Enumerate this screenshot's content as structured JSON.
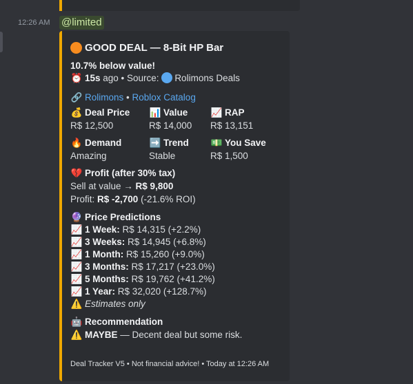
{
  "message": {
    "timestamp": "12:26 AM",
    "mention": "@limited"
  },
  "embed": {
    "accent_color": "#f0a800",
    "title": "GOOD DEAL — 8-Bit HP Bar",
    "below_value": "10.7% below value!",
    "age_value": "15s",
    "age_suffix": " ago • Source: ",
    "source": "Rolimons Deals",
    "links": {
      "rolimons": "Rolimons",
      "sep": " • ",
      "catalog": "Roblox Catalog"
    },
    "fields": [
      {
        "icon": "money-bag-icon",
        "name": "Deal Price",
        "value": "R$ 12,500"
      },
      {
        "icon": "bar-chart-icon",
        "name": "Value",
        "value": "R$ 14,000"
      },
      {
        "icon": "chart-up-icon",
        "name": "RAP",
        "value": "R$ 13,151"
      },
      {
        "icon": "fire-icon",
        "name": "Demand",
        "value": "Amazing"
      },
      {
        "icon": "arrow-right-icon",
        "name": "Trend",
        "value": "Stable"
      },
      {
        "icon": "dollar-bill-icon",
        "name": "You Save",
        "value": "R$ 1,500"
      }
    ],
    "profit": {
      "heading": "Profit (after 30% tax)",
      "sell_prefix": "Sell at value → ",
      "sell_value": "R$ 9,800",
      "profit_prefix": "Profit: ",
      "profit_value": "R$ -2,700",
      "profit_roi": " (-21.6% ROI)"
    },
    "predictions": {
      "heading": "Price Predictions",
      "items": [
        {
          "label": "1 Week:",
          "value": " R$ 14,315 (+2.2%)"
        },
        {
          "label": "3 Weeks:",
          "value": " R$ 14,945 (+6.8%)"
        },
        {
          "label": "1 Month:",
          "value": " R$ 15,260 (+9.0%)"
        },
        {
          "label": "3 Months:",
          "value": " R$ 17,217 (+23.0%)"
        },
        {
          "label": "5 Months:",
          "value": " R$ 19,762 (+41.2%)"
        },
        {
          "label": "1 Year:",
          "value": " R$ 32,020 (+128.7%)"
        }
      ],
      "note": "Estimates only"
    },
    "recommendation": {
      "heading": "Recommendation",
      "verdict": "MAYBE",
      "detail": " — Decent deal but some risk."
    },
    "footer": "Deal Tracker V5 • Not financial advice! • Today at 12:26 AM"
  }
}
